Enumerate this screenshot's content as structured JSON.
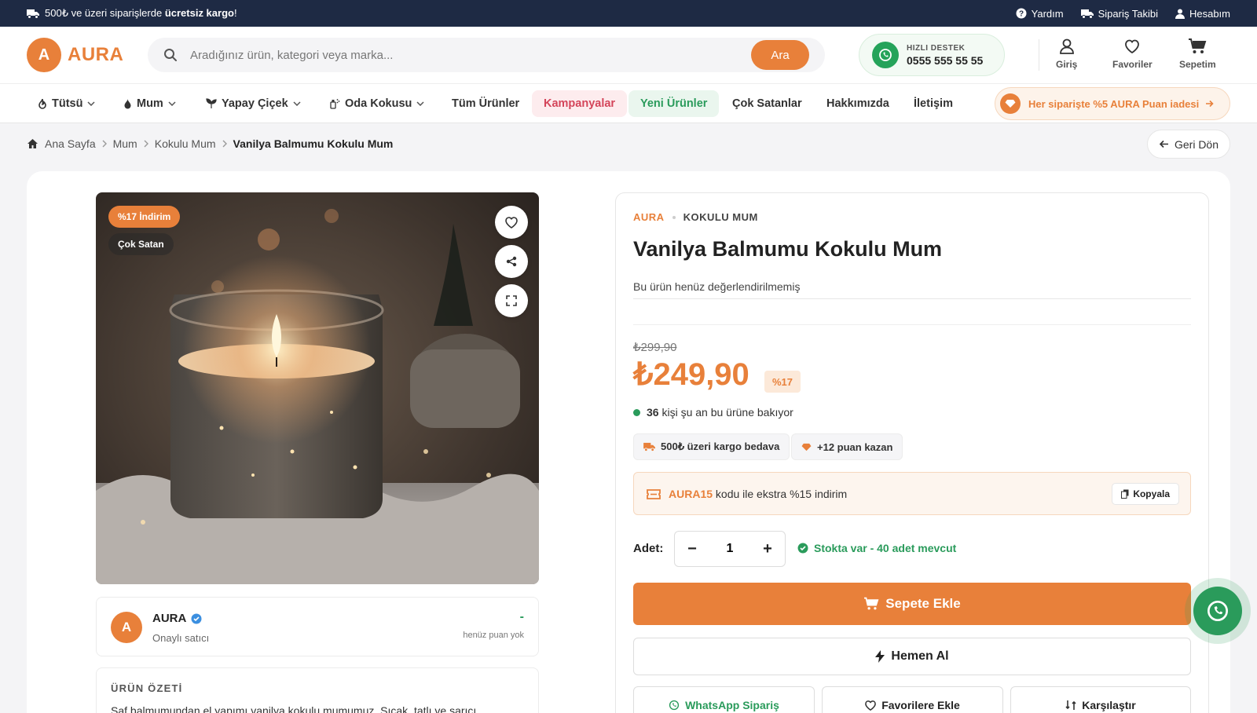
{
  "topbar": {
    "promo_prefix": "500₺ ve üzeri siparişlerde",
    "promo_bold": "ücretsiz kargo",
    "promo_suffix": "!",
    "links": [
      "Yardım",
      "Sipariş Takibi",
      "Hesabım"
    ]
  },
  "header": {
    "logo_letter": "A",
    "brand": "AURA",
    "search_placeholder": "Aradığınız ürün, kategori veya marka...",
    "search_button": "Ara",
    "support_label": "HIZLI DESTEK",
    "support_phone": "0555 555 55 55",
    "icons": {
      "login": "Giriş",
      "favorites": "Favoriler",
      "cart": "Sepetim"
    }
  },
  "nav": {
    "items": [
      "Tütsü",
      "Mum",
      "Yapay Çiçek",
      "Oda Kokusu",
      "Tüm Ürünler",
      "Kampanyalar",
      "Yeni Ürünler",
      "Çok Satanlar",
      "Hakkımızda",
      "İletişim"
    ],
    "points_banner": "Her siparişte %5 AURA Puan iadesi"
  },
  "breadcrumb": {
    "items": [
      "Ana Sayfa",
      "Mum",
      "Kokulu Mum"
    ],
    "current": "Vanilya Balmumu Kokulu Mum",
    "back": "Geri Dön"
  },
  "gallery": {
    "discount_badge": "%17 İndirim",
    "bestseller_badge": "Çok Satan"
  },
  "seller": {
    "avatar_letter": "A",
    "name": "AURA",
    "subtitle": "Onaylı satıcı",
    "rating": "-",
    "rating_note": "henüz puan yok"
  },
  "summary": {
    "heading": "ÜRÜN ÖZETİ",
    "text": "Saf balmumundan el yapımı vanilya kokulu mumumuz. Sıcak, tatlı ve sarıcı"
  },
  "product": {
    "brand": "AURA",
    "category": "KOKULU MUM",
    "title": "Vanilya Balmumu Kokulu Mum",
    "review_note": "Bu ürün henüz değerlendirilmemiş",
    "old_price": "₺299,90",
    "price": "₺249,90",
    "discount": "%17",
    "viewers_count": "36",
    "viewers_text": "kişi şu an bu ürüne bakıyor",
    "chips": [
      "500₺ üzeri kargo bedava",
      "+12 puan kazan"
    ],
    "coupon_code": "AURA15",
    "coupon_text": "kodu ile ekstra %15 indirim",
    "copy_button": "Kopyala",
    "qty_label": "Adet:",
    "qty_minus": "−",
    "qty_value": "1",
    "qty_plus": "+",
    "stock_text": "Stokta var - 40 adet mevcut",
    "add_to_cart": "Sepete Ekle",
    "buy_now": "Hemen Al",
    "whatsapp_order": "WhatsApp Sipariş",
    "add_favorites": "Favorilere Ekle",
    "compare": "Karşılaştır"
  },
  "colors": {
    "accent": "#e8803a",
    "dark_navy": "#1e2a44",
    "green": "#2a9b5b",
    "kampanya_bg": "#fdecee",
    "kampanya_text": "#d4455a",
    "yeni_bg": "#eaf6ee",
    "yeni_text": "#2a9b5b"
  }
}
